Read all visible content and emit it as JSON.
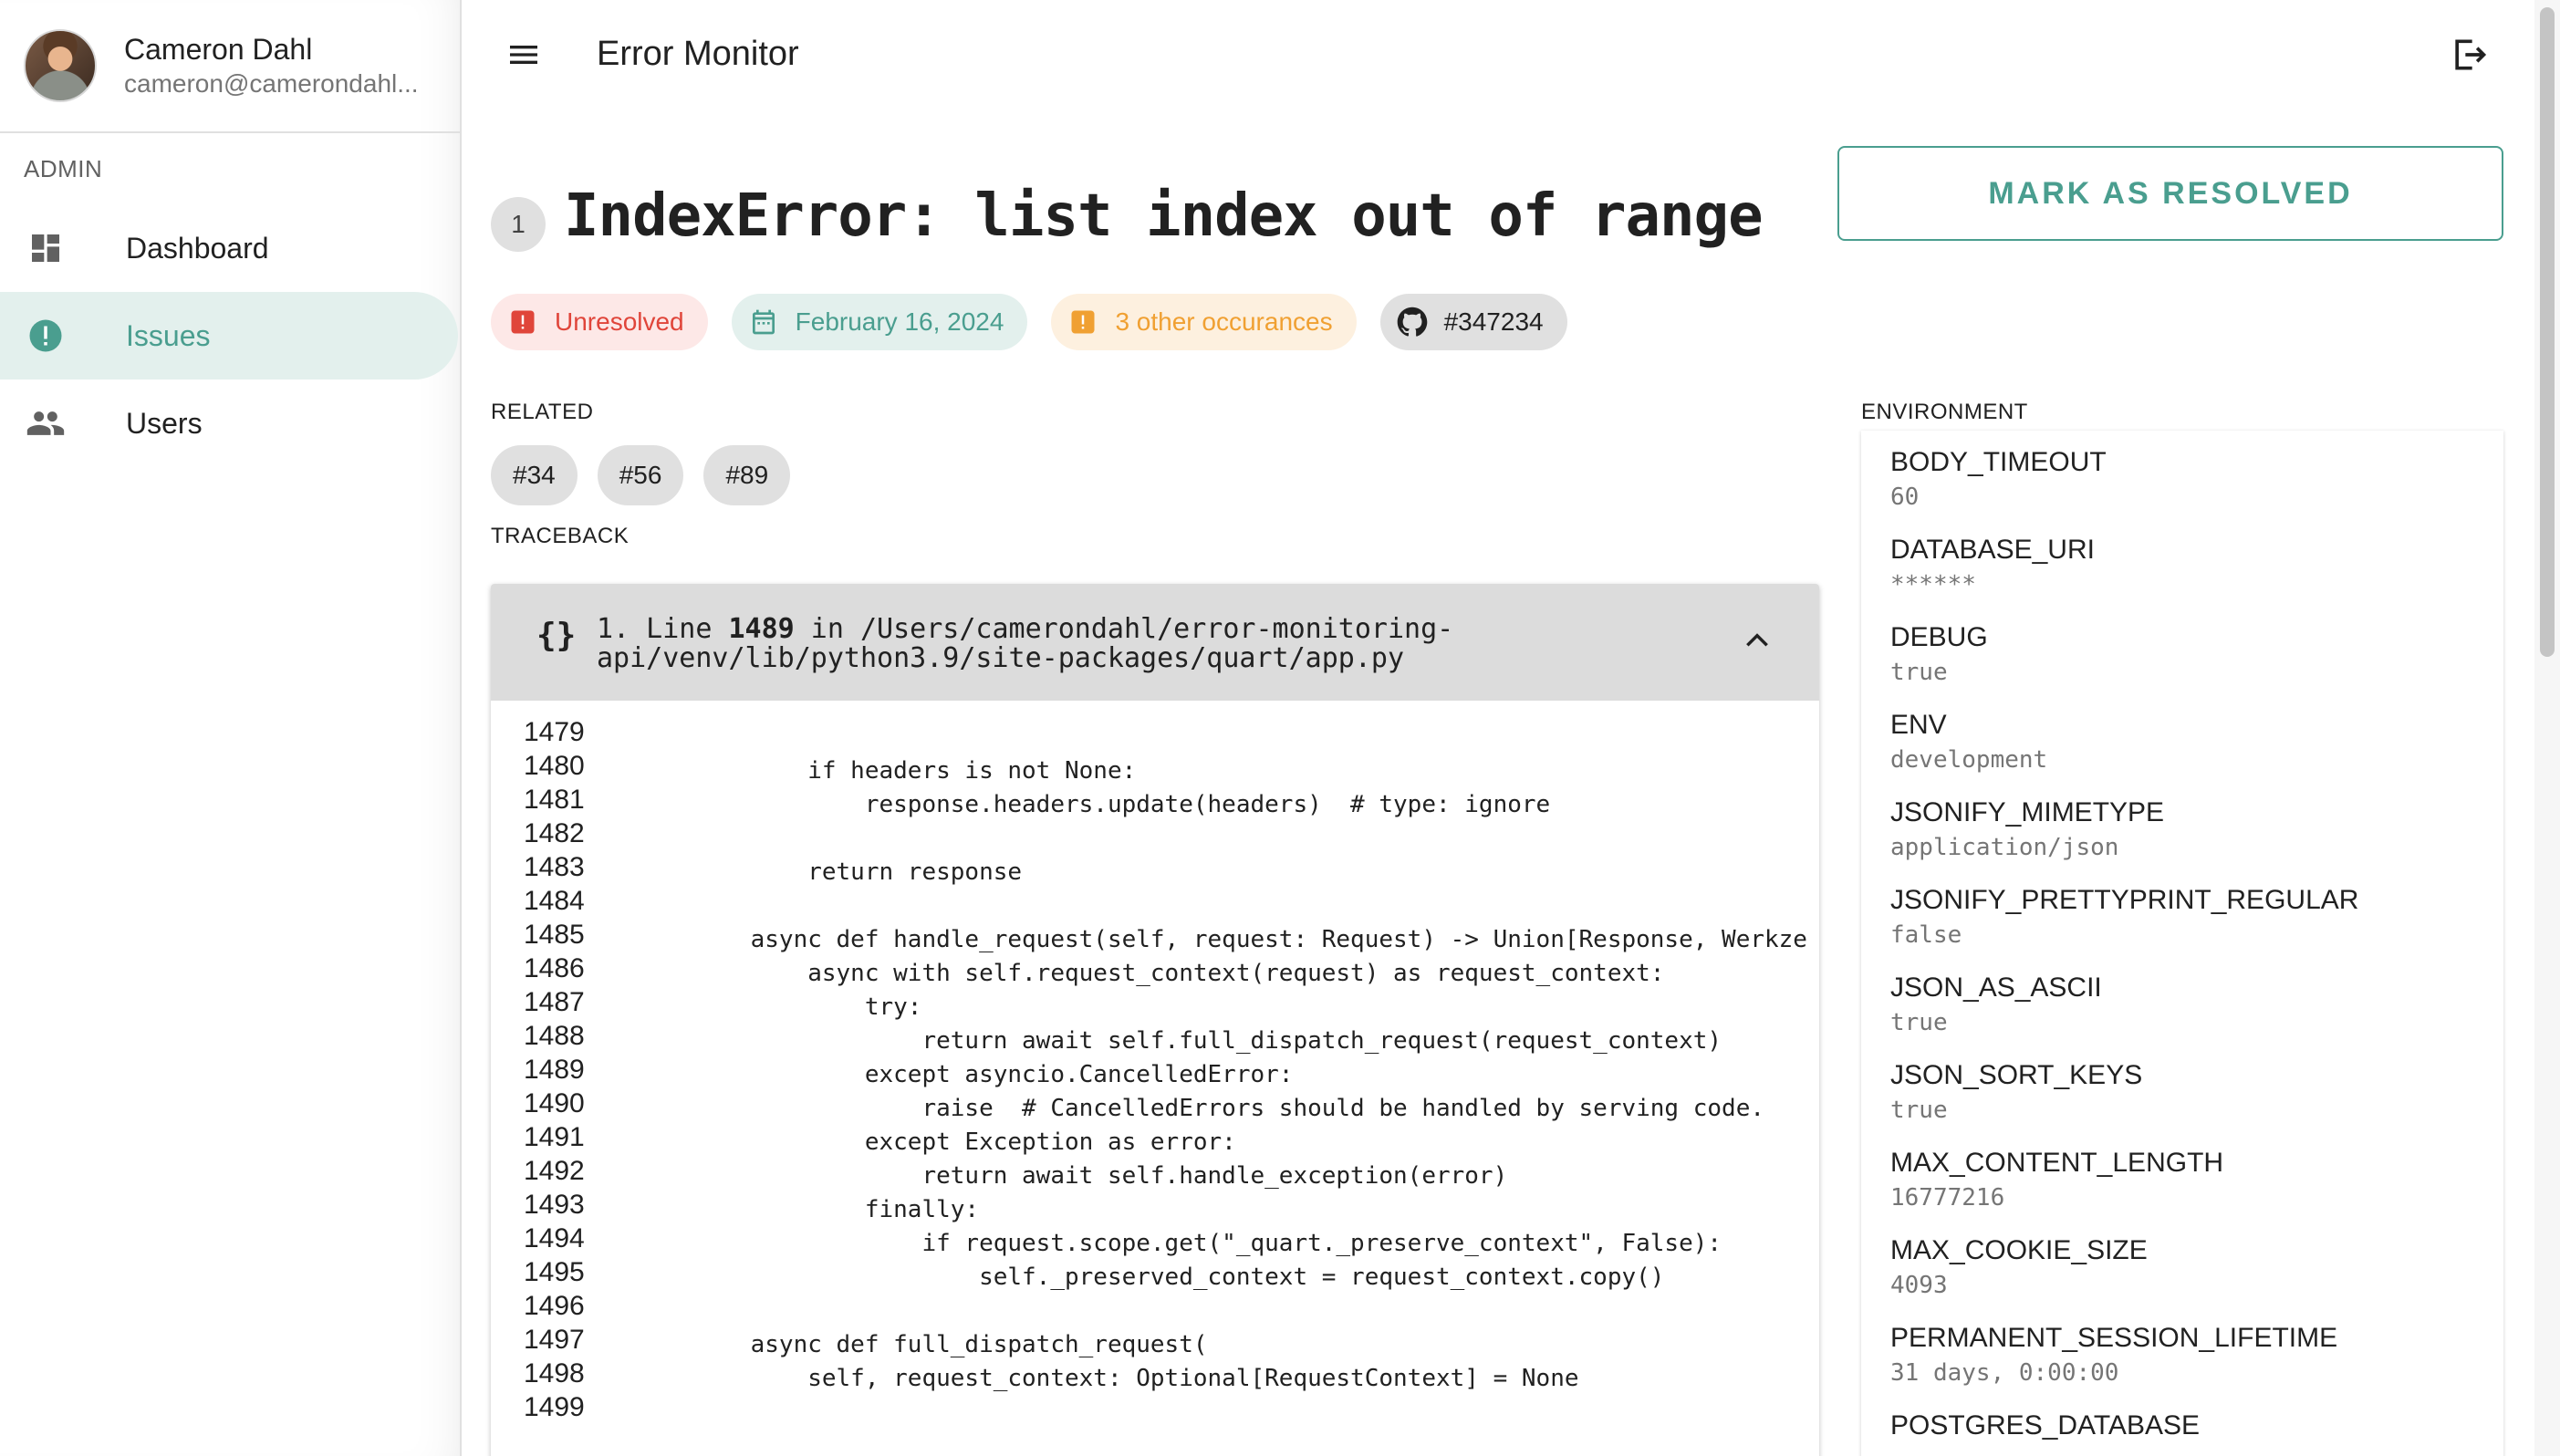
{
  "user": {
    "name": "Cameron Dahl",
    "email": "cameron@camerondahl..."
  },
  "sidebar": {
    "section_label": "ADMIN",
    "items": [
      {
        "label": "Dashboard",
        "icon": "dashboard-icon",
        "active": false
      },
      {
        "label": "Issues",
        "icon": "alert-circle-icon",
        "active": true
      },
      {
        "label": "Users",
        "icon": "users-icon",
        "active": false
      }
    ]
  },
  "header": {
    "title": "Error Monitor"
  },
  "issue": {
    "occurrence_count": "1",
    "title": "IndexError: list index out of range",
    "resolve_label": "MARK AS RESOLVED",
    "chips": {
      "status": "Unresolved",
      "date": "February 16, 2024",
      "occurrences": "3 other occurances",
      "github": "#347234"
    },
    "related_label": "RELATED",
    "related": [
      "#34",
      "#56",
      "#89"
    ],
    "traceback_label": "TRACEBACK"
  },
  "traceback": {
    "frame_prefix": "1. Line ",
    "line_number": "1489",
    "frame_middle": " in /Users/camerondahl/error-monitoring-",
    "frame_path_2": "api/venv/lib/python3.9/site-packages/quart/app.py",
    "lines": [
      {
        "n": "1479",
        "code": ""
      },
      {
        "n": "1480",
        "code": "        if headers is not None:"
      },
      {
        "n": "1481",
        "code": "            response.headers.update(headers)  # type: ignore"
      },
      {
        "n": "1482",
        "code": ""
      },
      {
        "n": "1483",
        "code": "        return response"
      },
      {
        "n": "1484",
        "code": ""
      },
      {
        "n": "1485",
        "code": "    async def handle_request(self, request: Request) -> Union[Response, WerkzeugR"
      },
      {
        "n": "1486",
        "code": "        async with self.request_context(request) as request_context:"
      },
      {
        "n": "1487",
        "code": "            try:"
      },
      {
        "n": "1488",
        "code": "                return await self.full_dispatch_request(request_context)"
      },
      {
        "n": "1489",
        "code": "            except asyncio.CancelledError:"
      },
      {
        "n": "1490",
        "code": "                raise  # CancelledErrors should be handled by serving code."
      },
      {
        "n": "1491",
        "code": "            except Exception as error:"
      },
      {
        "n": "1492",
        "code": "                return await self.handle_exception(error)"
      },
      {
        "n": "1493",
        "code": "            finally:"
      },
      {
        "n": "1494",
        "code": "                if request.scope.get(\"_quart._preserve_context\", False):"
      },
      {
        "n": "1495",
        "code": "                    self._preserved_context = request_context.copy()"
      },
      {
        "n": "1496",
        "code": ""
      },
      {
        "n": "1497",
        "code": "    async def full_dispatch_request("
      },
      {
        "n": "1498",
        "code": "        self, request_context: Optional[RequestContext] = None"
      },
      {
        "n": "1499",
        "code": ""
      }
    ]
  },
  "environment": {
    "label": "ENVIRONMENT",
    "items": [
      {
        "key": "BODY_TIMEOUT",
        "value": "60"
      },
      {
        "key": "DATABASE_URI",
        "value": "******"
      },
      {
        "key": "DEBUG",
        "value": "true"
      },
      {
        "key": "ENV",
        "value": "development"
      },
      {
        "key": "JSONIFY_MIMETYPE",
        "value": "application/json"
      },
      {
        "key": "JSONIFY_PRETTYPRINT_REGULAR",
        "value": "false"
      },
      {
        "key": "JSON_AS_ASCII",
        "value": "true"
      },
      {
        "key": "JSON_SORT_KEYS",
        "value": "true"
      },
      {
        "key": "MAX_CONTENT_LENGTH",
        "value": "16777216"
      },
      {
        "key": "MAX_COOKIE_SIZE",
        "value": "4093"
      },
      {
        "key": "PERMANENT_SESSION_LIFETIME",
        "value": "31 days, 0:00:00"
      },
      {
        "key": "POSTGRES_DATABASE",
        "value": ""
      }
    ]
  },
  "colors": {
    "accent": "#4a9e8f",
    "error": "#e0453a",
    "warning": "#f0a032"
  }
}
